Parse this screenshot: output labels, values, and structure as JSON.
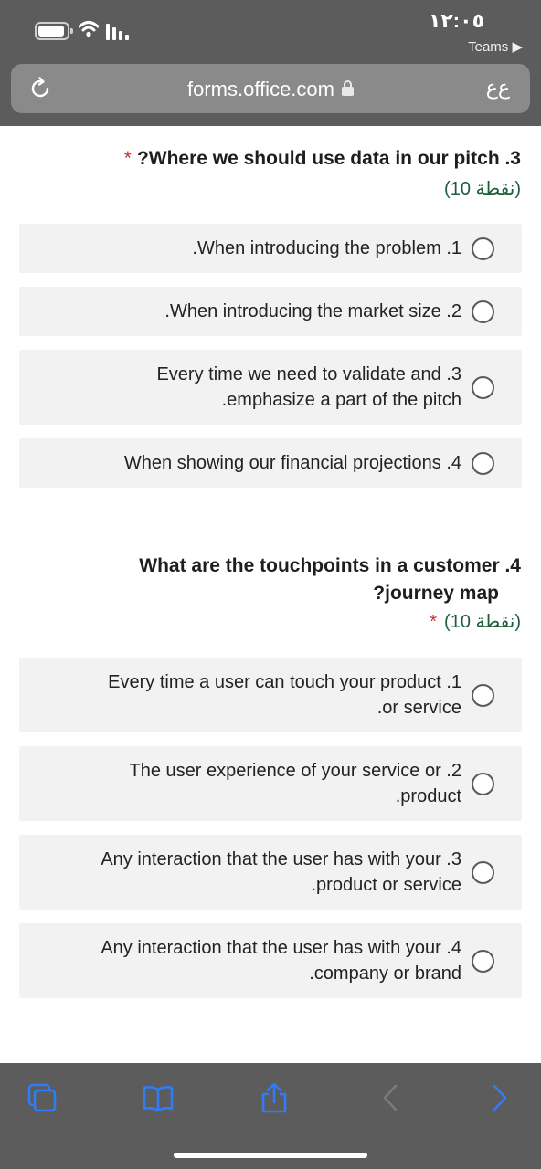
{
  "status": {
    "time": "١٢:٠٥",
    "back_app": "Teams ▶"
  },
  "browser": {
    "url": "forms.office.com",
    "text_size_label": "ﻉﻉ"
  },
  "questions": [
    {
      "title_line1": "?Where we should use data in our pitch .3",
      "title_line2": "",
      "required_mark": "*",
      "points": "(10 نقطة)",
      "options": [
        {
          "line1": ".When introducing the problem .1",
          "line2": ""
        },
        {
          "line1": ".When introducing the market size .2",
          "line2": ""
        },
        {
          "line1": "Every time we need to validate and .3",
          "line2": ".emphasize a part of the pitch"
        },
        {
          "line1": "When showing our financial projections .4",
          "line2": ""
        }
      ]
    },
    {
      "title_line1": "What are the touchpoints in a customer .4",
      "title_line2": "?journey map",
      "required_mark": "*",
      "points": "(10 نقطة)",
      "options": [
        {
          "line1": "Every time a user can touch your product .1",
          "line2": ".or service"
        },
        {
          "line1": "The user experience of your service or .2",
          "line2": ".product"
        },
        {
          "line1": "Any interaction that the user has with your .3",
          "line2": ".product or service"
        },
        {
          "line1": "Any interaction that the user has with your .4",
          "line2": ".company or brand"
        }
      ]
    }
  ],
  "toolbar_icons": [
    "tabs-icon",
    "bookmarks-icon",
    "share-icon",
    "back-arrow-icon",
    "forward-arrow-icon"
  ],
  "colors": {
    "chrome": "#5c5c5c",
    "accent": "#2f7cf6",
    "required": "#c8302e",
    "points": "#1c5e3b"
  }
}
